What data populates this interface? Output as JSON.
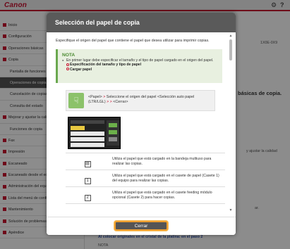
{
  "app": {
    "logo": "Canon",
    "top_icons": [
      "gear-icon",
      "question-icon"
    ]
  },
  "sidebar": {
    "items": [
      {
        "label": "Inicio",
        "level": 0
      },
      {
        "label": "Configuración",
        "level": 0
      },
      {
        "label": "Operaciones básicas",
        "level": 0
      },
      {
        "label": "Copia",
        "level": 0
      },
      {
        "label": "Pantalla de funciones",
        "level": 1
      },
      {
        "label": "Operaciones de copia",
        "level": 1,
        "active": true
      },
      {
        "label": "Cancelación de copias",
        "level": 1
      },
      {
        "label": "Consulta del estado",
        "level": 1
      },
      {
        "label": "Mejorar y ajustar la calidad",
        "level": 0
      },
      {
        "label": "Funciones de copia",
        "level": 1
      },
      {
        "label": "Fax",
        "level": 0
      },
      {
        "label": "Impresión",
        "level": 0
      },
      {
        "label": "Escaneado",
        "level": 0
      },
      {
        "label": "Escaneado desde el equipo",
        "level": 0
      },
      {
        "label": "Administración del equipo",
        "level": 0
      },
      {
        "label": "Lista del menú de configuración",
        "level": 0
      },
      {
        "label": "Mantenimiento",
        "level": 0
      },
      {
        "label": "Solución de problemas",
        "level": 0
      },
      {
        "label": "Apéndice",
        "level": 0
      }
    ]
  },
  "content": {
    "id_code": "1X0E-0X9",
    "heading_partial": "básicas de copia.",
    "side_note": "y ajustar la calidad",
    "side_note2": "ar.",
    "bottom_link": "Al colocar originales en el cristal de la platina: en el paso 2",
    "bottom_label": "NOTA"
  },
  "modal": {
    "title": "Selección del papel de copia",
    "intro": "Especifique el origen del papel que contiene el papel que desea utilizar para imprimir copias.",
    "nota": {
      "title": "NOTA",
      "text": "En primer lugar debe especificar el tamaño y el tipo de papel cargado en el origen del papel.",
      "links": [
        "Especificación del tamaño y tipo de papel",
        "Cargar papel"
      ]
    },
    "step": {
      "part1": "<Papel>",
      "arrow": ">",
      "part2": "Seleccione el origen del papel",
      "arrow2": ">",
      "part3": "<Selección auto papel (LTR/LGL)",
      "arrow3": "> >",
      "part4": "<Cerrar>"
    },
    "options": [
      {
        "icon": "multipurpose-tray-icon",
        "glyph": "▤",
        "text": "Utiliza el papel que está cargado en la bandeja multiuso para realizar las copias."
      },
      {
        "icon": "drawer-1-icon",
        "glyph": "1",
        "text": "Utiliza el papel que está cargado en el casete de papel (Casete 1) del equipo para realizar las copias."
      },
      {
        "icon": "drawer-2-icon",
        "glyph": "2",
        "text": "Utiliza el papel que está cargado en el casete feeding módulo opcional (Casete 2) para hacer copias."
      }
    ],
    "close_label": "Cerrar"
  }
}
